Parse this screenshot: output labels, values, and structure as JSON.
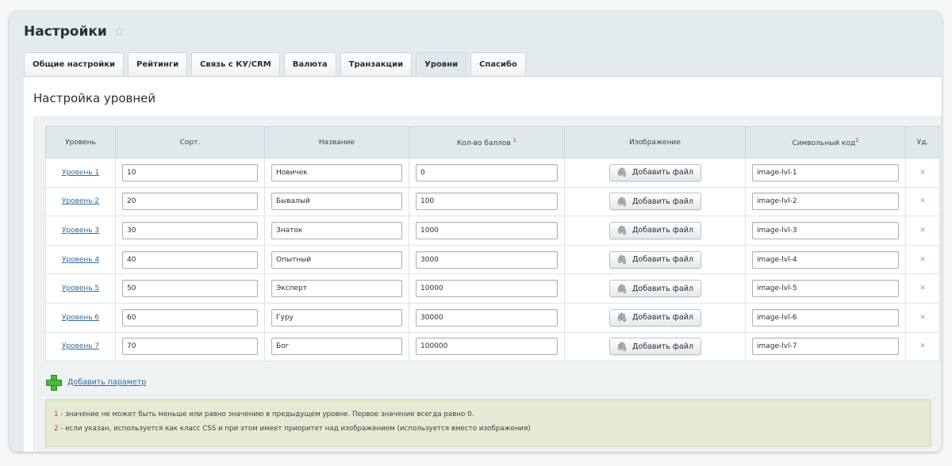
{
  "page": {
    "title": "Настройки",
    "star_icon": "star-icon"
  },
  "tabs": [
    {
      "label": "Общие настройки",
      "active": false
    },
    {
      "label": "Рейтинги",
      "active": false
    },
    {
      "label": "Связь с КУ/CRM",
      "active": false
    },
    {
      "label": "Валюта",
      "active": false
    },
    {
      "label": "Транзакции",
      "active": false
    },
    {
      "label": "Уровни",
      "active": true
    },
    {
      "label": "Спасибо",
      "active": false
    }
  ],
  "section": {
    "title": "Настройка уровней"
  },
  "table": {
    "headers": {
      "level": "Уровень",
      "sort": "Сорт.",
      "name": "Название",
      "points": "Кол-во баллов",
      "points_note": "1",
      "image": "Изображение",
      "code": "Символьный код",
      "code_note": "2",
      "delete": "Уд."
    },
    "add_file_label": "Добавить файл",
    "rows": [
      {
        "level": "Уровень 1",
        "sort": "10",
        "name": "Новичек",
        "points": "0",
        "code": "image-lvl-1"
      },
      {
        "level": "Уровень 2",
        "sort": "20",
        "name": "Бывалый",
        "points": "100",
        "code": "image-lvl-2"
      },
      {
        "level": "Уровень 3",
        "sort": "30",
        "name": "Знаток",
        "points": "1000",
        "code": "image-lvl-3"
      },
      {
        "level": "Уровень 4",
        "sort": "40",
        "name": "Опытный",
        "points": "3000",
        "code": "image-lvl-4"
      },
      {
        "level": "Уровень 5",
        "sort": "50",
        "name": "Эксперт",
        "points": "10000",
        "code": "image-lvl-5"
      },
      {
        "level": "Уровень 6",
        "sort": "60",
        "name": "Гуру",
        "points": "30000",
        "code": "image-lvl-6"
      },
      {
        "level": "Уровень 7",
        "sort": "70",
        "name": "Бог",
        "points": "100000",
        "code": "image-lvl-7"
      }
    ]
  },
  "add_param": {
    "label": "Добавить параметр"
  },
  "notes": [
    {
      "num": "1",
      "text": " - значение не может быть меньше или равно значению в предыдущем уровне. Первое значение всегда равно 0."
    },
    {
      "num": "2",
      "text": " - если указан, используется как класс CSS и при этом имеет приоритет над изображением (используется вместо изображения)"
    }
  ]
}
